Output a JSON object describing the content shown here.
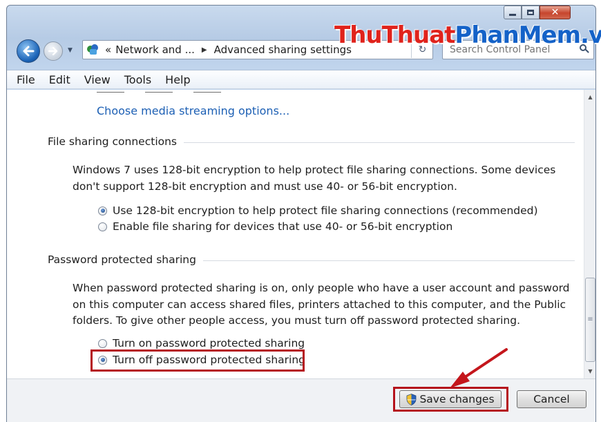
{
  "window": {
    "controls": {
      "minimize": "minimize",
      "maximize": "maximize",
      "close": "✕"
    }
  },
  "nav": {
    "address_prefix": "«",
    "breadcrumb_1": "Network and ...",
    "breadcrumb_2": "Advanced sharing settings",
    "search_placeholder": "Search Control Panel"
  },
  "watermark": {
    "part1": "ThuThuat",
    "part2": "PhanMem",
    "part3": ".vn"
  },
  "menu": [
    "File",
    "Edit",
    "View",
    "Tools",
    "Help"
  ],
  "content": {
    "media_link": "Choose media streaming options...",
    "file_sharing": {
      "title": "File sharing connections",
      "description": "Windows 7 uses 128-bit encryption to help protect file sharing connections. Some devices don't support 128-bit encryption and must use 40- or 56-bit encryption.",
      "options": [
        {
          "label": "Use 128-bit encryption to help protect file sharing connections (recommended)",
          "checked": true
        },
        {
          "label": "Enable file sharing for devices that use 40- or 56-bit encryption",
          "checked": false
        }
      ]
    },
    "password_sharing": {
      "title": "Password protected sharing",
      "description": "When password protected sharing is on, only people who have a user account and password on this computer can access shared files, printers attached to this computer, and the Public folders. To give other people access, you must turn off password protected sharing.",
      "options": [
        {
          "label": "Turn on password protected sharing",
          "checked": false
        },
        {
          "label": "Turn off password protected sharing",
          "checked": true
        }
      ]
    }
  },
  "footer": {
    "save_label": "Save changes",
    "cancel_label": "Cancel"
  },
  "colors": {
    "highlight": "#b5121b",
    "link": "#1c5fb4",
    "watermark_red": "#e0231c",
    "watermark_blue": "#1462c8"
  },
  "icons": {
    "save": "uac-shield-icon",
    "back": "back-arrow-icon",
    "forward": "forward-arrow-icon"
  }
}
